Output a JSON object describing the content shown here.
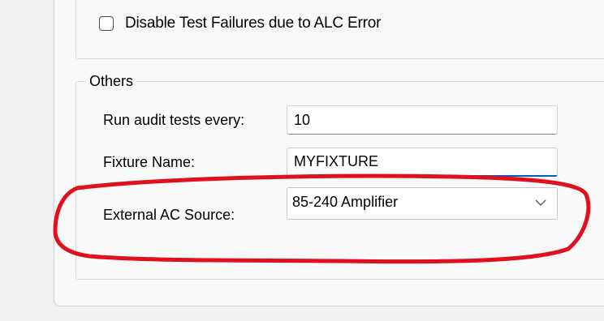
{
  "settings": {
    "disable_alc_label": "Disable Test Failures due to ALC Error",
    "disable_alc_checked": false,
    "others": {
      "title": "Others",
      "audit_label": "Run audit tests every:",
      "audit_value": "10",
      "fixture_label": "Fixture Name:",
      "fixture_value": "MYFIXTURE",
      "ac_source_label": "External AC Source:",
      "ac_source_value": "85-240 Amplifier"
    }
  },
  "colors": {
    "annotation": "#e0101e",
    "focus": "#005fb8"
  },
  "icons": {
    "dropdown": "chevron-down-icon"
  }
}
